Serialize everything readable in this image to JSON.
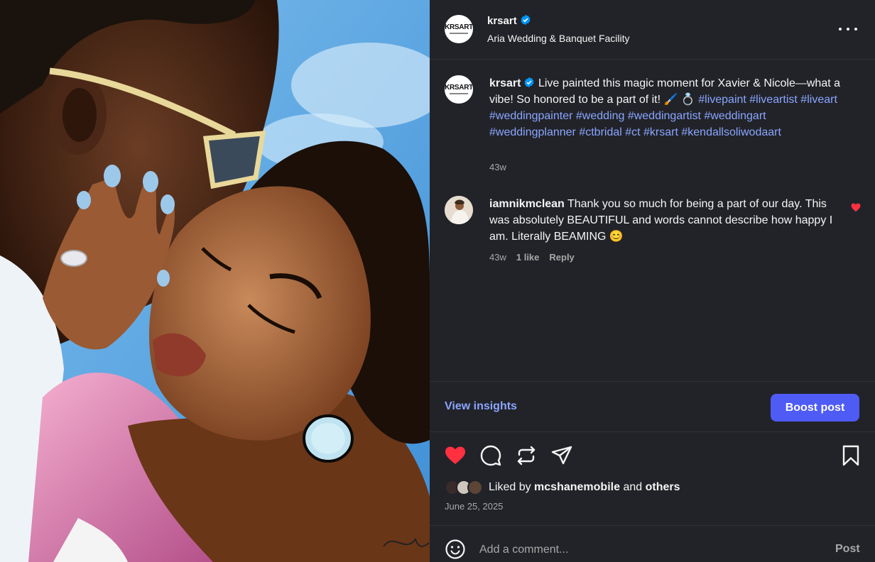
{
  "post": {
    "username": "krsart",
    "location": "Aria Wedding & Banquet Facility",
    "avatar_logo": "KRSART"
  },
  "caption": {
    "username": "krsart",
    "text": "Live painted this magic moment for Xavier & Nicole—what a vibe! So honored to be a part of it! 🖌️ 💍",
    "hashtags": "#livepaint #liveartist #liveart #weddingpainter #wedding #weddingartist #weddingart #weddingplanner #ctbridal #ct #krsart #kendallsoliwodaart",
    "time": "43w"
  },
  "comment": {
    "username": "iamnikmclean",
    "text": "Thank you so much for being a part of our day. This was absolutely BEAUTIFUL and words cannot describe how happy I am. Literally BEAMING 😊",
    "time": "43w",
    "likes": "1 like",
    "reply": "Reply"
  },
  "insights": {
    "view_label": "View insights",
    "boost_label": "Boost post"
  },
  "likes": {
    "prefix": "Liked by",
    "user": "mcshanemobile",
    "joiner": "and",
    "others": "others"
  },
  "date": "June 25, 2025",
  "comment_box": {
    "placeholder": "Add a comment...",
    "post_label": "Post"
  },
  "colors": {
    "accent_link": "#8ba5ff",
    "boost_button": "#4f5bf5",
    "like_red": "#ff3040",
    "verified_blue": "#0095f6",
    "panel_bg": "#212328"
  },
  "icons": [
    "verified-icon",
    "more-options-icon",
    "heart-icon",
    "comment-icon",
    "repost-icon",
    "share-icon",
    "bookmark-icon",
    "emoji-icon"
  ]
}
